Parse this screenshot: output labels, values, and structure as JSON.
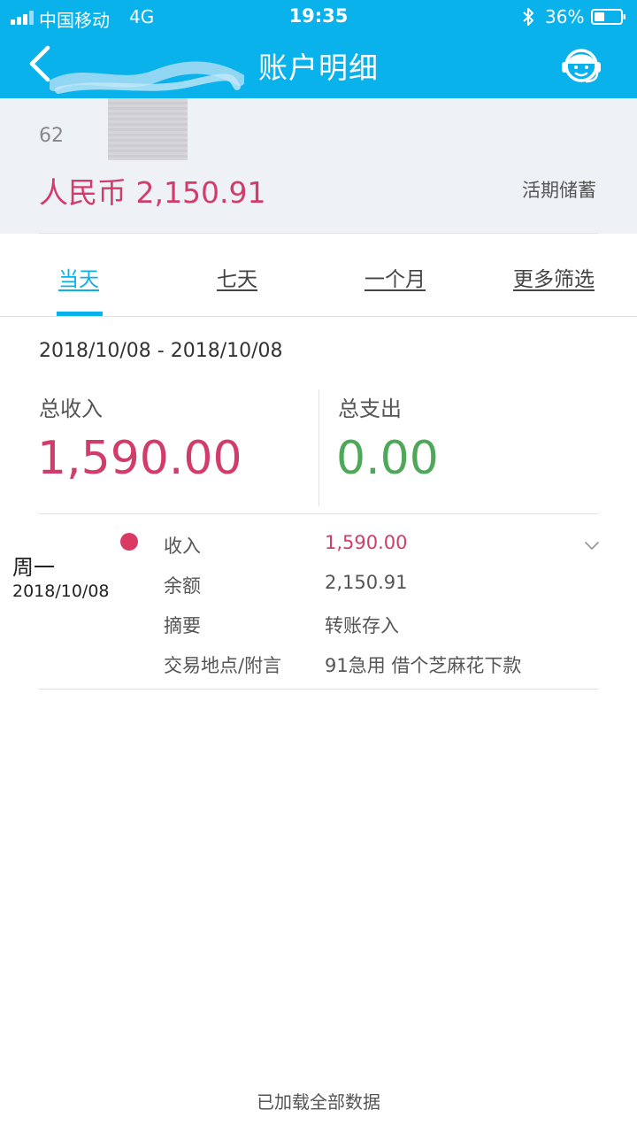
{
  "status_bar": {
    "carrier": "中国移动",
    "network": "4G",
    "time": "19:35",
    "battery_percent": "36%"
  },
  "nav": {
    "title": "账户明细",
    "back_icon": "chevron-left-icon",
    "service_icon": "customer-service-icon"
  },
  "account": {
    "number_prefix": "62",
    "balance": "人民币 2,150.91",
    "type": "活期储蓄"
  },
  "tabs": [
    {
      "label": "当天",
      "active": true
    },
    {
      "label": "七天",
      "active": false
    },
    {
      "label": "一个月",
      "active": false
    },
    {
      "label": "更多筛选",
      "active": false
    }
  ],
  "summary": {
    "date_range": "2018/10/08 - 2018/10/08",
    "income_label": "总收入",
    "income_value": "1,590.00",
    "expense_label": "总支出",
    "expense_value": "0.00"
  },
  "transaction": {
    "weekday": "周一",
    "date": "2018/10/08",
    "rows": [
      {
        "label": "收入",
        "value": "1,590.00"
      },
      {
        "label": "余额",
        "value": "2,150.91"
      },
      {
        "label": "摘要",
        "value": "转账存入"
      },
      {
        "label": "交易地点/附言",
        "value": "91急用 借个芝麻花下款"
      }
    ]
  },
  "footer": {
    "loaded_all": "已加载全部数据"
  },
  "colors": {
    "primary": "#0ab2ec",
    "income": "#d23c6a",
    "expense": "#4fa85a",
    "header_bg": "#eef1f5"
  }
}
